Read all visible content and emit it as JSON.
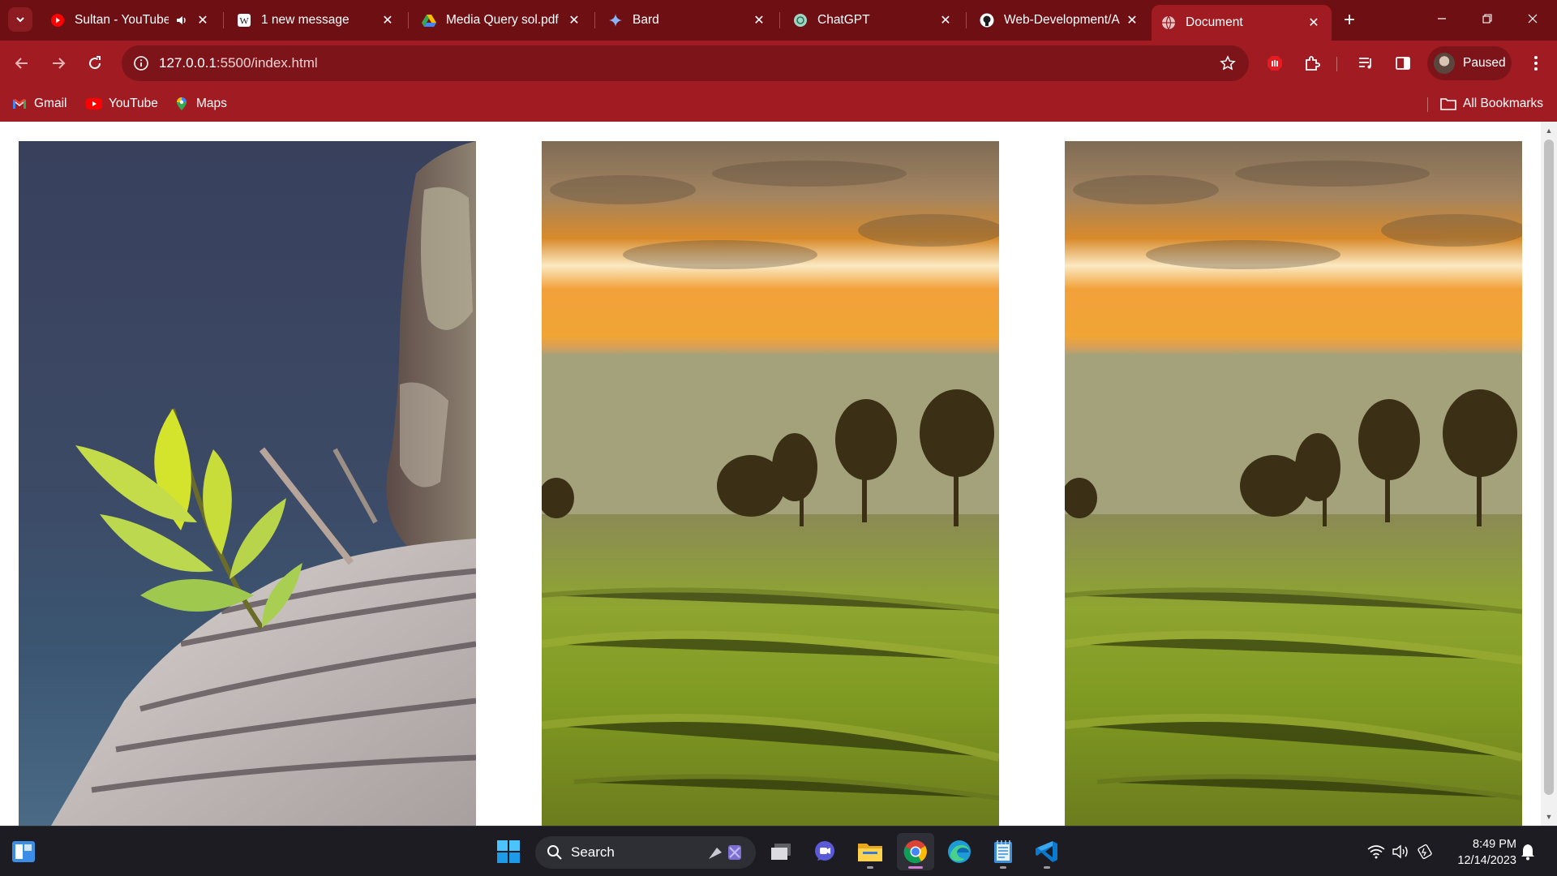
{
  "browser": {
    "tabs": [
      {
        "title": "Sultan - YouTube",
        "icon": "youtube-icon",
        "audio": true
      },
      {
        "title": "1 new message",
        "icon": "wordpress-icon"
      },
      {
        "title": "Media Query sol.pdf",
        "icon": "google-drive-icon"
      },
      {
        "title": "Bard",
        "icon": "bard-sparkle-icon"
      },
      {
        "title": "ChatGPT",
        "icon": "chatgpt-icon"
      },
      {
        "title": "Web-Development/A",
        "icon": "github-icon"
      },
      {
        "title": "Document",
        "icon": "globe-icon",
        "active": true
      }
    ],
    "address": {
      "host": "127.0.0.1",
      "path": ":5500/index.html"
    },
    "profile_label": "Paused",
    "bookmarks": [
      {
        "label": "Gmail",
        "icon": "gmail-icon"
      },
      {
        "label": "YouTube",
        "icon": "youtube-icon"
      },
      {
        "label": "Maps",
        "icon": "maps-icon"
      }
    ],
    "all_bookmarks_label": "All Bookmarks",
    "theme_colors": {
      "frame": "#6e0f14",
      "toolbar": "#a11c22",
      "omnibox": "#7c1419"
    }
  },
  "page": {
    "images": [
      {
        "subject": "green-leaf-on-wood-photo"
      },
      {
        "subject": "sunset-field-photo"
      },
      {
        "subject": "sunset-field-photo"
      }
    ]
  },
  "taskbar": {
    "search_label": "Search",
    "time": "8:49 PM",
    "date": "12/14/2023",
    "apps": [
      "start-icon",
      "task-view-icon",
      "teams-chat-icon",
      "file-explorer-icon",
      "chrome-icon",
      "edge-icon",
      "notepad-icon",
      "vscode-icon"
    ]
  }
}
